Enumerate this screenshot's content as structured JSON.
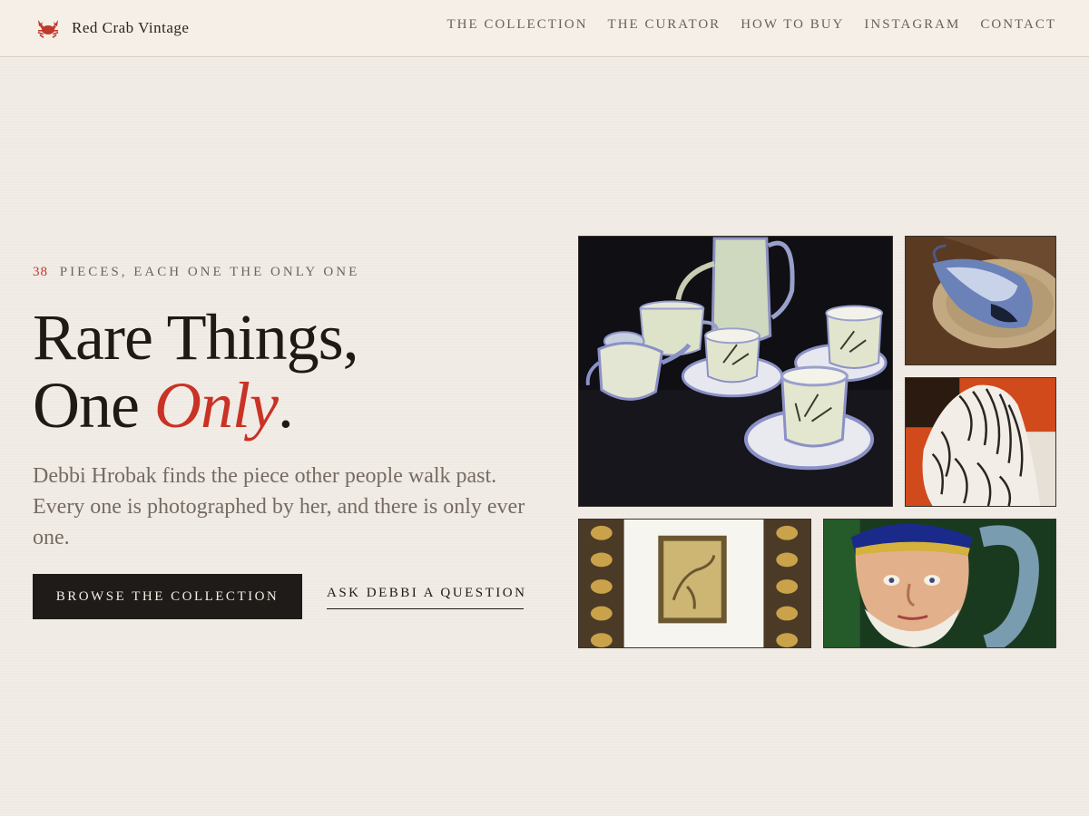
{
  "brand": {
    "name": "Red Crab Vintage",
    "icon": "crab-icon",
    "icon_color": "#c0392b"
  },
  "nav": {
    "items": [
      "THE COLLECTION",
      "THE CURATOR",
      "HOW TO BUY",
      "INSTAGRAM",
      "CONTACT"
    ]
  },
  "hero": {
    "eyebrow_count": "38",
    "eyebrow_text": "PIECES, EACH ONE THE ONLY ONE",
    "headline_line1": "Rare Things,",
    "headline_line2_prefix": "One",
    "headline_line2_accent": "Only",
    "headline_line2_suffix": ".",
    "lede": "Debbi Hrobak finds the piece other people walk past. Every one is photographed by her, and there is only ever one.",
    "primary_cta": "BROWSE THE COLLECTION",
    "secondary_cta": "ASK DEBBI A QUESTION"
  },
  "colors": {
    "accent": "#c93225",
    "dark": "#1e1b18",
    "background": "#f1ece5"
  },
  "gallery": [
    "lusterware-tea-set-photo",
    "glass-whale-photo",
    "zebra-figurine-photo",
    "framed-gilt-print-photo",
    "sea-captain-toby-jug-photo"
  ]
}
